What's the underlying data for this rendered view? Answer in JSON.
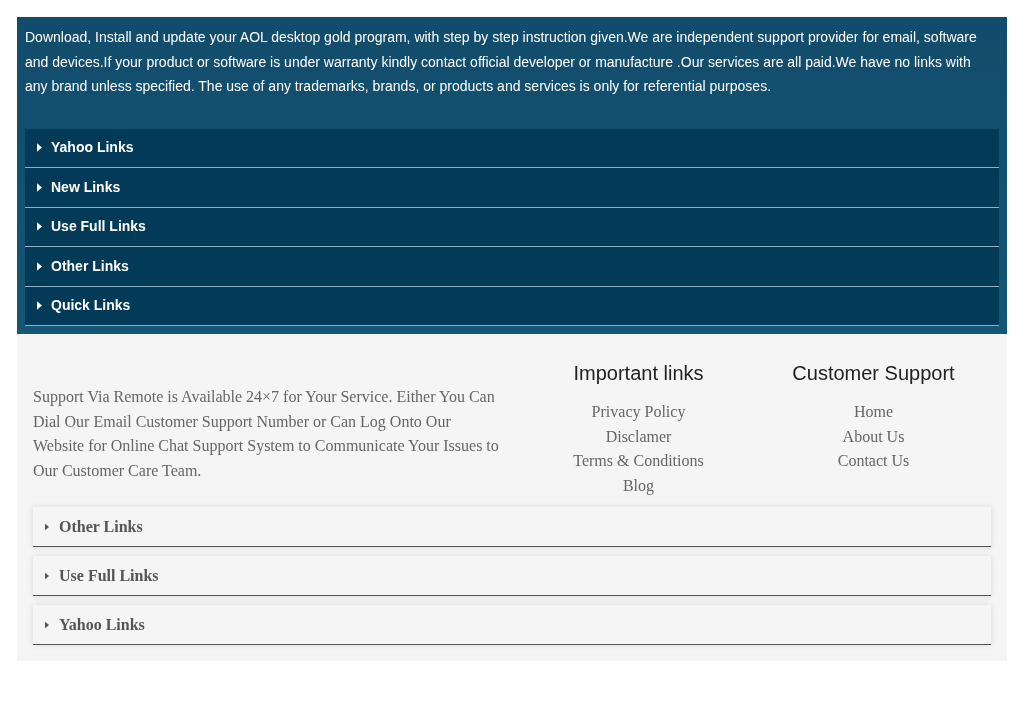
{
  "disclaimer": "Download, Install and update your AOL desktop gold program, with step by step instruction given.We are independent support provider for email, software and devices.If your product or software is under warranty kindly contact official developer or manufacture .Our services are all paid.We have no links with any brand unless specified. The use of any trademarks, brands, or products and services is only for referential purposes.",
  "top_accordion": [
    {
      "label": "Yahoo Links",
      "expanded": false
    },
    {
      "label": "New Links",
      "expanded": false
    },
    {
      "label": "Use Full Links",
      "expanded": false
    },
    {
      "label": "Other Links",
      "expanded": false
    },
    {
      "label": "Quick Links",
      "expanded": false
    }
  ],
  "footer": {
    "about": "Support Via Remote is Available 24×7 for Your Service. Either You Can Dial Our Email Customer Support Number or Can Log Onto Our Website for Online Chat Support System to Communicate Your Issues to Our Customer Care Team.",
    "columns": [
      {
        "title": "Important links",
        "links": [
          "Privacy Policy",
          "Disclamer",
          "Terms & Conditions",
          "Blog"
        ]
      },
      {
        "title": "Customer Support",
        "links": [
          "Home",
          "About Us",
          "Contact Us"
        ]
      }
    ],
    "accordion": [
      {
        "label": "Other Links",
        "expanded": false
      },
      {
        "label": "Use Full Links",
        "expanded": false
      },
      {
        "label": "Yahoo Links",
        "expanded": false
      }
    ]
  }
}
